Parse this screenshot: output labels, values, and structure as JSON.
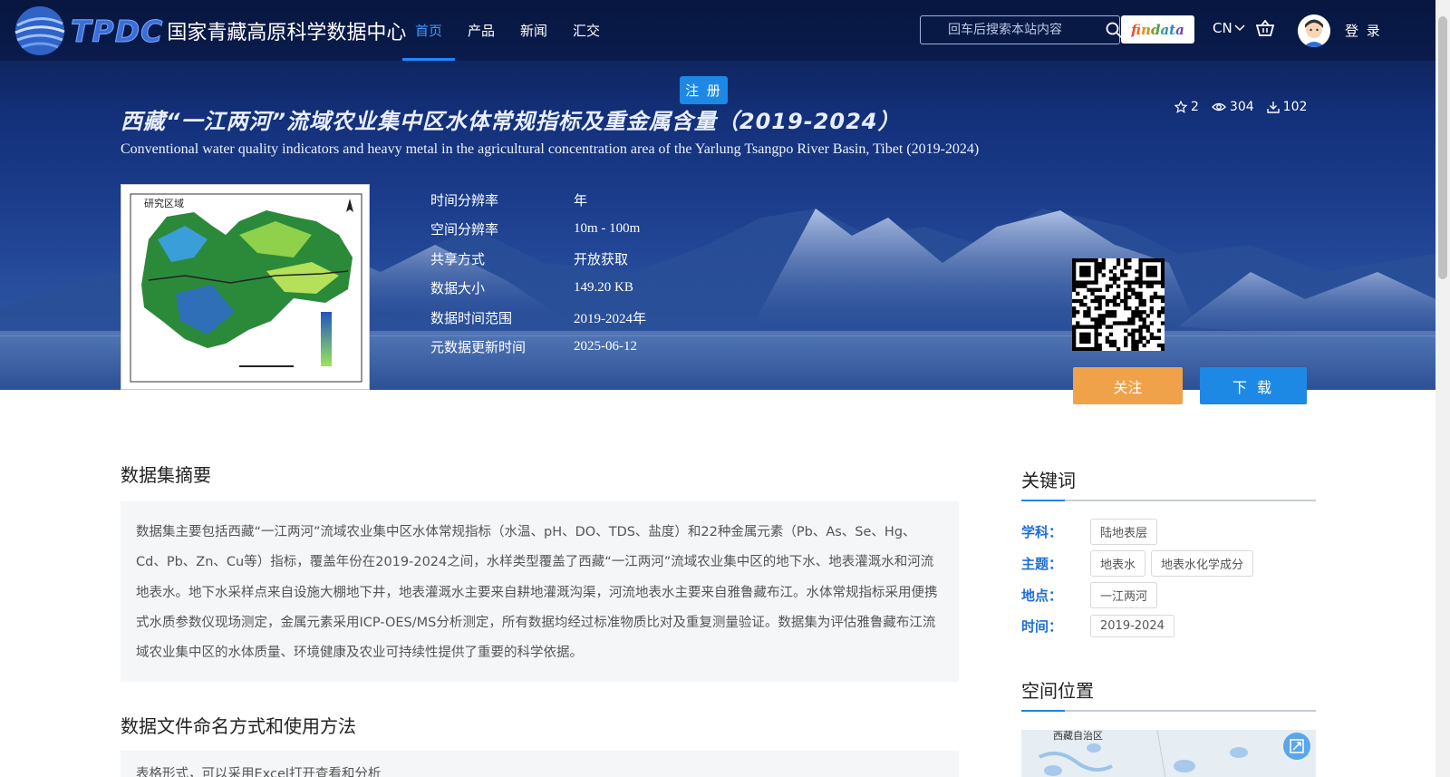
{
  "header": {
    "logo_text": "TPDC",
    "site_name": "国家青藏高原科学数据中心",
    "nav": [
      {
        "label": "首页",
        "active": true
      },
      {
        "label": "产品",
        "active": false
      },
      {
        "label": "新闻",
        "active": false
      },
      {
        "label": "汇交",
        "active": false
      }
    ],
    "search_placeholder": "回车后搜索本站内容",
    "findata_label": "findata",
    "lang": "CN",
    "login_label": "登 录",
    "register_label": "注 册"
  },
  "dataset": {
    "title_cn": "西藏“一江两河”流域农业集中区水体常规指标及重金属含量（2019-2024）",
    "title_en": "Conventional water quality indicators and heavy metal in the agricultural concentration area of the Yarlung Tsangpo River Basin, Tibet (2019-2024)",
    "stats": {
      "stars": "2",
      "views": "304",
      "downloads": "102"
    },
    "thumbnail_label": "研究区域",
    "meta": [
      {
        "key": "时间分辨率",
        "value": "年"
      },
      {
        "key": "空间分辨率",
        "value": "10m - 100m"
      },
      {
        "key": "共享方式",
        "value": "开放获取"
      },
      {
        "key": "数据大小",
        "value": "149.20 KB"
      },
      {
        "key": "数据时间范围",
        "value": "2019-2024年"
      },
      {
        "key": "元数据更新时间",
        "value": "2025-06-12"
      }
    ],
    "follow_label": "关注",
    "download_label": "下 载"
  },
  "main": {
    "abstract_title": "数据集摘要",
    "abstract_text": "数据集主要包括西藏“一江两河”流域农业集中区水体常规指标（水温、pH、DO、TDS、盐度）和22种金属元素（Pb、As、Se、Hg、Cd、Pb、Zn、Cu等）指标，覆盖年份在2019-2024之间，水样类型覆盖了西藏“一江两河”流域农业集中区的地下水、地表灌溉水和河流地表水。地下水采样点来自设施大棚地下井，地表灌溉水主要来自耕地灌溉沟渠，河流地表水主要来自雅鲁藏布江。水体常规指标采用便携式水质参数仪现场测定，金属元素采用ICP-OES/MS分析测定，所有数据均经过标准物质比对及重复测量验证。数据集为评估雅鲁藏布江流域农业集中区的水体质量、环境健康及农业可持续性提供了重要的科学依据。",
    "naming_title": "数据文件命名方式和使用方法",
    "naming_text": "表格形式，可以采用Excel打开查看和分析"
  },
  "sidebar": {
    "keywords_title": "关键词",
    "keywords": [
      {
        "label": "学科：",
        "tags": [
          "陆地表层"
        ]
      },
      {
        "label": "主题：",
        "tags": [
          "地表水",
          "地表水化学成分"
        ]
      },
      {
        "label": "地点：",
        "tags": [
          "一江两河"
        ]
      },
      {
        "label": "时间：",
        "tags": [
          "2019-2024"
        ]
      }
    ],
    "location_title": "空间位置",
    "map_label": "西藏自治区"
  },
  "colors": {
    "accent": "#1e88e5",
    "follow": "#f0a24a",
    "keyword_label": "#1e6ed6"
  }
}
